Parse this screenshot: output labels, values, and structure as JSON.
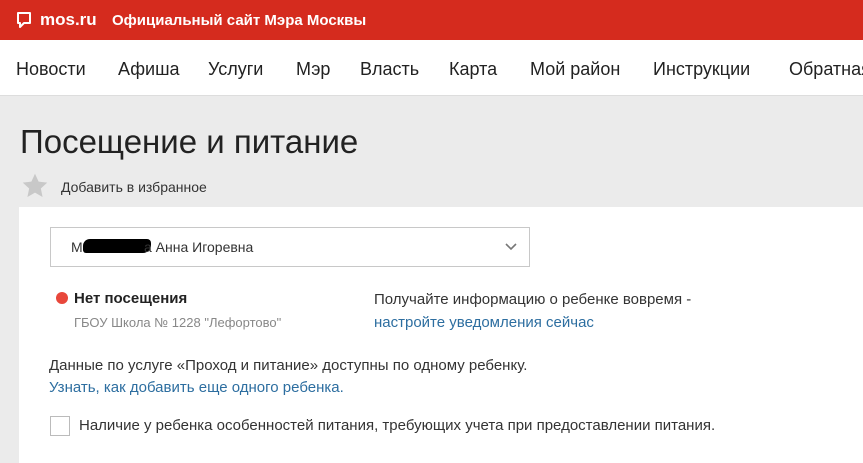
{
  "header": {
    "logo": "mos.ru",
    "site_title": "Официальный сайт Мэра Москвы"
  },
  "nav": {
    "items": [
      "Новости",
      "Афиша",
      "Услуги",
      "Мэр",
      "Власть",
      "Карта",
      "Мой район",
      "Инструкции",
      "Обратная связь"
    ]
  },
  "page": {
    "title": "Посещение и питание",
    "favorite_label": "Добавить в избранное"
  },
  "child": {
    "first_letter": "М",
    "name_rest": "а Анна Игоревна"
  },
  "status": {
    "title": "Нет посещения",
    "school": "ГБОУ Школа № 1228 \"Лефортово\"",
    "dot_color": "#e8473b"
  },
  "notify": {
    "text": "Получайте информацию о ребенке вовремя -",
    "link": "настройте уведомления сейчас"
  },
  "info": {
    "text": "Данные по услуге «Проход и питание» доступны по одному ребенку.",
    "link": "Узнать, как добавить еще одного ребенка."
  },
  "diet": {
    "label": "Наличие у ребенка особенностей питания, требующих учета при предоставлении питания.",
    "checked": false
  },
  "colors": {
    "brand": "#d52b1e",
    "link": "#2d6ea0"
  }
}
